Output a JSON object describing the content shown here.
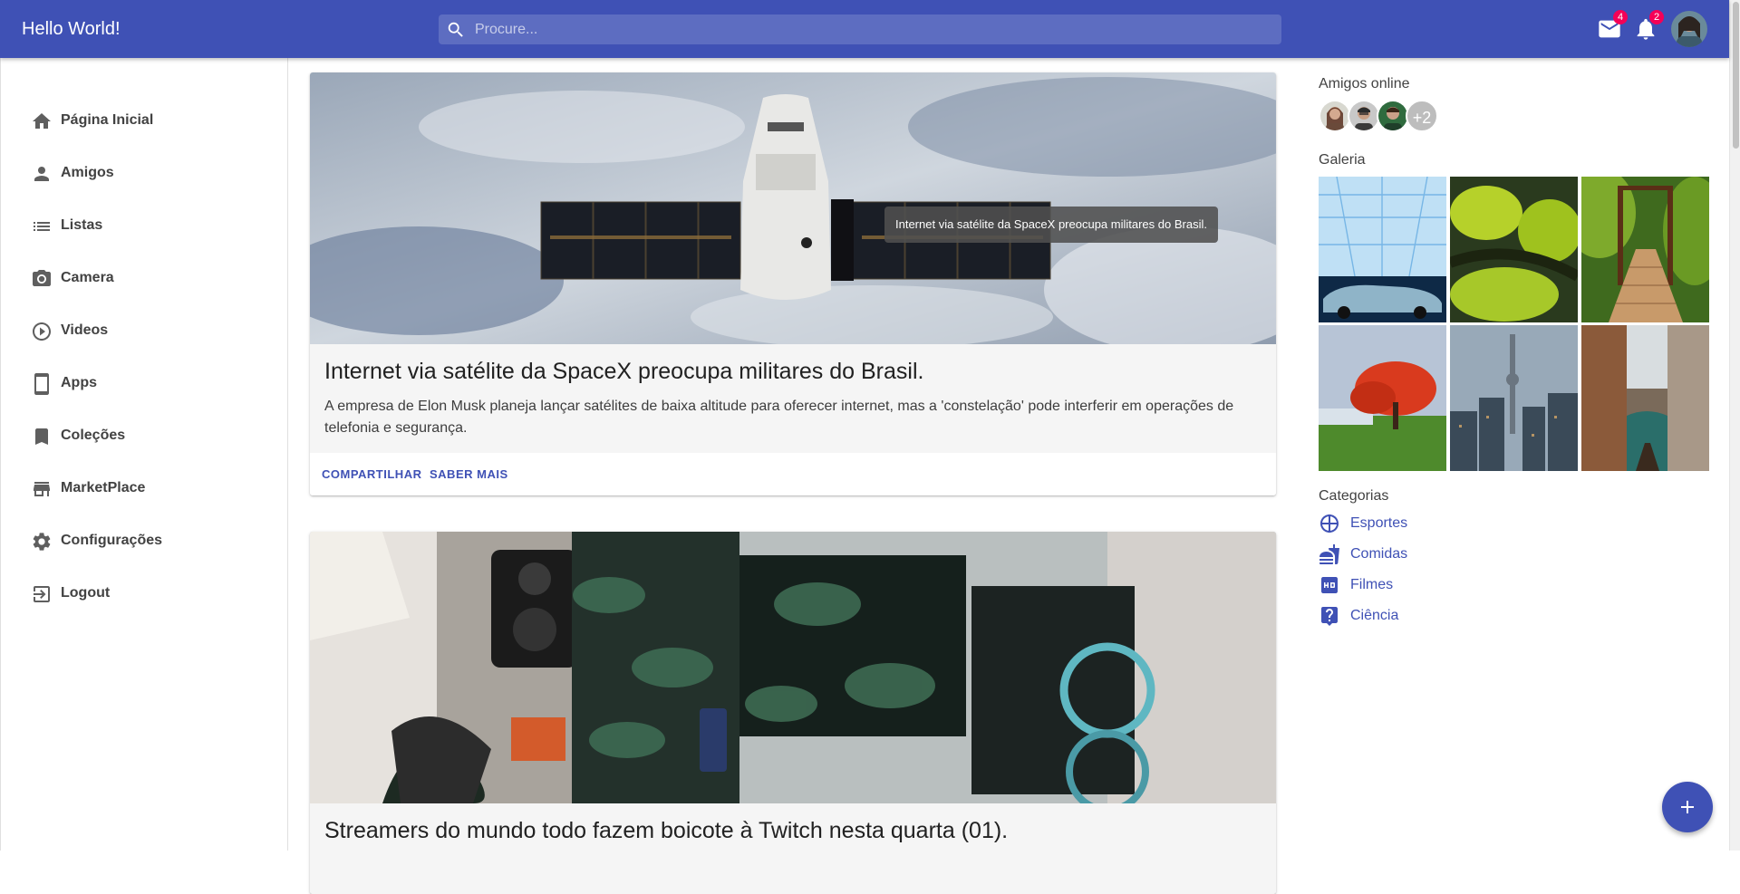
{
  "app": {
    "title": "Hello World!"
  },
  "search": {
    "placeholder": "Procure..."
  },
  "header": {
    "mail_badge": "4",
    "notifications_badge": "2"
  },
  "sidebar": {
    "items": [
      {
        "label": "Página Inicial",
        "icon": "home-icon"
      },
      {
        "label": "Amigos",
        "icon": "person-icon"
      },
      {
        "label": "Listas",
        "icon": "list-icon"
      },
      {
        "label": "Camera",
        "icon": "camera-icon"
      },
      {
        "label": "Videos",
        "icon": "play-circle-icon"
      },
      {
        "label": "Apps",
        "icon": "tablet-icon"
      },
      {
        "label": "Coleções",
        "icon": "bookmark-icon"
      },
      {
        "label": "MarketPlace",
        "icon": "store-icon"
      },
      {
        "label": "Configurações",
        "icon": "settings-icon"
      },
      {
        "label": "Logout",
        "icon": "logout-icon"
      }
    ]
  },
  "feed": {
    "posts": [
      {
        "title": "Internet via satélite da SpaceX preocupa militares do Brasil.",
        "text": "A empresa de Elon Musk planeja lançar satélites de baixa altitude para oferecer internet, mas a 'constelação' pode interferir em operações de telefonia e segurança.",
        "tooltip": "Internet via satélite da SpaceX preocupa militares do Brasil.",
        "share_label": "COMPARTILHAR",
        "more_label": "SABER MAIS"
      },
      {
        "title": "Streamers do mundo todo fazem boicote à Twitch nesta quarta (01)."
      }
    ]
  },
  "right": {
    "friends_title": "Amigos online",
    "friends_more": "+2",
    "gallery_title": "Galeria",
    "categories_title": "Categorias",
    "categories": [
      {
        "label": "Esportes",
        "icon": "sports-icon"
      },
      {
        "label": "Comidas",
        "icon": "food-icon"
      },
      {
        "label": "Filmes",
        "icon": "hd-icon"
      },
      {
        "label": "Ciência",
        "icon": "help-box-icon"
      }
    ]
  },
  "colors": {
    "primary": "#3f51b5",
    "badge": "#f50057"
  }
}
